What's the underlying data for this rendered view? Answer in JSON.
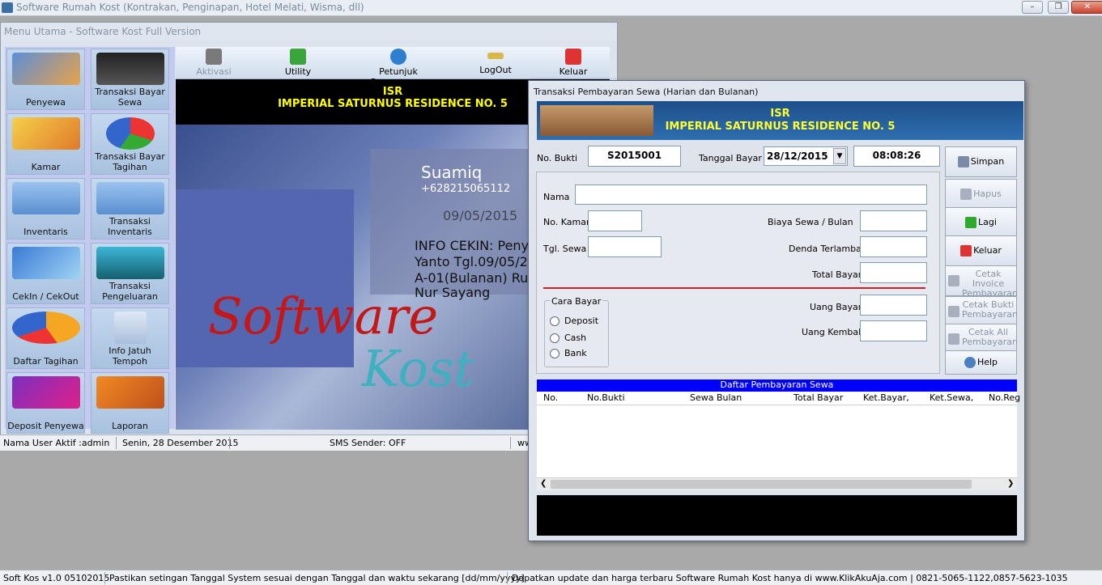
{
  "app": {
    "title": "Software Rumah Kost (Kontrakan, Penginapan, Hotel Melati, Wisma, dll)",
    "minimize": "–",
    "restore": "❐",
    "close": "✕"
  },
  "main": {
    "title": "Menu Utama - Software Kost Full Version",
    "menu": [
      {
        "label": "Penyewa",
        "icon": "person-folder-icon"
      },
      {
        "label": "Transaksi Bayar Sewa",
        "icon": "cash-register-icon"
      },
      {
        "label": "Kamar",
        "icon": "room-folder-icon"
      },
      {
        "label": "Transaksi Bayar Tagihan",
        "icon": "pie-chart-icon"
      },
      {
        "label": "Inventaris",
        "icon": "folder-stack-icon"
      },
      {
        "label": "Transaksi Inventaris",
        "icon": "folder-stack-icon"
      },
      {
        "label": "CekIn / CekOut",
        "icon": "open-folder-icon"
      },
      {
        "label": "Transaksi Pengeluaran",
        "icon": "download-tray-icon"
      },
      {
        "label": "Daftar Tagihan",
        "icon": "checkmark-chart-icon"
      },
      {
        "label": "Info Jatuh Tempoh",
        "icon": "calendar-icon"
      },
      {
        "label": "Deposit Penyewa",
        "icon": "keyboard-icon"
      },
      {
        "label": "Laporan",
        "icon": "report-arrow-icon"
      }
    ],
    "toolbar": {
      "aktivasi": "Aktivasi",
      "utility": "Utility",
      "petunjuk": "Petunjuk Penggunaan",
      "logout": "LogOut",
      "keluar": "Keluar"
    },
    "banner": {
      "line1": "ISR",
      "line2": "IMPERIAL SATURNUS RESIDENCE NO. 5"
    },
    "photo": {
      "sender": "Suamiq",
      "phone": "+628215065112",
      "date": "09/05/2015",
      "sms1": "INFO CEKIN: Peny",
      "sms2": "Yanto Tgl.09/05/2",
      "sms3": "A-01(Bulanan) Ru",
      "sms4": "Nur Sayang",
      "logo1": "Software",
      "logo2": "Kost"
    },
    "status": {
      "user": "Nama User Aktif :admin",
      "date": "Senin, 28 Desember 2015",
      "sms": "SMS Sender: OFF",
      "extra": "ww"
    }
  },
  "dialog": {
    "title": "Transaksi Pembayaran Sewa (Harian dan Bulanan)",
    "banner": {
      "line1": "ISR",
      "line2": "IMPERIAL SATURNUS RESIDENCE NO. 5"
    },
    "no_bukti_label": "No. Bukti",
    "no_bukti": "S2015001",
    "tanggal_label": "Tanggal Bayar",
    "tanggal": "28/12/2015",
    "time": "08:08:26",
    "nama_label": "Nama",
    "kamar_label": "No. Kamar",
    "tgl_sewa_label": "Tgl. Sewa",
    "biaya_label": "Biaya Sewa / Bulan",
    "denda_label": "Denda Terlambat",
    "total_label": "Total Bayar",
    "uang_bayar_label": "Uang Bayar",
    "uang_kembali_label": "Uang Kembali",
    "cara_bayar_label": "Cara Bayar",
    "options": [
      "Deposit",
      "Cash",
      "Bank"
    ],
    "buttons": {
      "simpan": "Simpan",
      "hapus": "Hapus",
      "lagi": "Lagi",
      "keluar": "Keluar",
      "cetak_invoice": "Cetak Invoice Pembayaran",
      "cetak_bukti": "Cetak Bukti Pembayaran",
      "cetak_all": "Cetak All Pembayaran",
      "help": "Help"
    },
    "list_title": "Daftar Pembayaran Sewa",
    "columns": [
      "No.",
      "No.Bukti",
      "Sewa Bulan",
      "Total Bayar",
      "Ket.Bayar,",
      "Ket.Sewa,",
      "No.Reg"
    ]
  },
  "footer": {
    "version": "Soft Kos v1.0 05102015",
    "hint": "Pastikan setingan Tanggal System sesuai dengan Tanggal dan waktu sekarang [dd/mm/yyyy]",
    "update": "Dapatkan update dan harga terbaru Software Rumah Kost hanya di www.KlikAkuAja.com | 0821-5065-1122,0857-5623-1035"
  }
}
